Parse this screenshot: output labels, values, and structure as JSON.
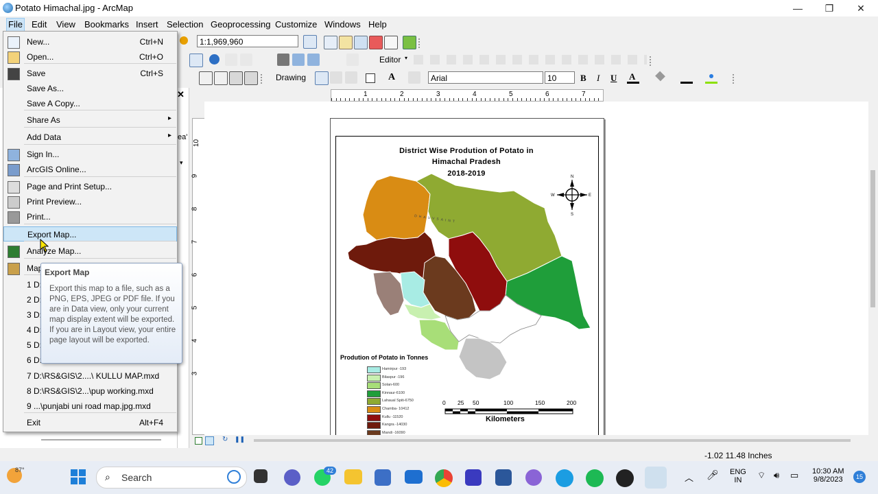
{
  "window": {
    "title": "Potato Himachal.jpg - ArcMap",
    "minimize": "—",
    "maximize": "❐",
    "close": "✕"
  },
  "menubar": [
    "File",
    "Edit",
    "View",
    "Bookmarks",
    "Insert",
    "Selection",
    "Geoprocessing",
    "Customize",
    "Windows",
    "Help"
  ],
  "toolbar": {
    "scale": "1:1,969,960",
    "editor": "Editor",
    "drawing": "Drawing",
    "font": "Arial",
    "font_size": "10",
    "bold": "B",
    "italic": "I",
    "underline": "U",
    "text_tool": "A"
  },
  "file_menu": {
    "items": [
      {
        "label": "New...",
        "shortcut": "Ctrl+N"
      },
      {
        "label": "Open...",
        "shortcut": "Ctrl+O"
      },
      {
        "label": "Save",
        "shortcut": "Ctrl+S"
      },
      {
        "label": "Save As...",
        "shortcut": ""
      },
      {
        "label": "Save A Copy...",
        "shortcut": ""
      },
      {
        "label": "Share As",
        "submenu": "▸"
      },
      {
        "label": "Add Data",
        "submenu": "▸"
      },
      {
        "label": "Sign In...",
        "shortcut": ""
      },
      {
        "label": "ArcGIS Online...",
        "shortcut": ""
      },
      {
        "label": "Page and Print Setup...",
        "shortcut": ""
      },
      {
        "label": "Print Preview...",
        "shortcut": ""
      },
      {
        "label": "Print...",
        "shortcut": ""
      },
      {
        "label": "Export Map...",
        "shortcut": ""
      },
      {
        "label": "Analyze Map...",
        "shortcut": ""
      },
      {
        "label": "Map",
        "shortcut": ""
      },
      {
        "label": "1 D:",
        "shortcut": ""
      },
      {
        "label": "2 D:",
        "shortcut": ""
      },
      {
        "label": "3 D:",
        "shortcut": ""
      },
      {
        "label": "4 D:",
        "shortcut": ""
      },
      {
        "label": "5 D:",
        "shortcut": ""
      },
      {
        "label": "6 D:",
        "shortcut": ""
      },
      {
        "label": "7 D:\\RS&GIS\\2....\\ KULLU MAP.mxd",
        "shortcut": ""
      },
      {
        "label": "8 D:\\RS&GIS\\2...\\pup working.mxd",
        "shortcut": ""
      },
      {
        "label": "9 ...\\punjabi uni road map.jpg.mxd",
        "shortcut": ""
      },
      {
        "label": "Exit",
        "shortcut": "Alt+F4"
      }
    ],
    "highlighted": "Export Map..."
  },
  "tooltip": {
    "title": "Export Map",
    "body": "Export this map to a file, such as a PNG, EPS, JPEG or PDF file. If you are in Data view, only your current map display extent will be exported. If you are in Layout view, your entire page layout will be exported."
  },
  "layout": {
    "map_title_line1": "District Wise Prodution of Potato in",
    "map_title_line2": "Himachal Pradesh",
    "map_title_line3": "2018-2019",
    "legend_title": "Prodution of Potato in Tonnes",
    "legend": [
      {
        "label": "Hamirpur -193",
        "color": "#a8ece4"
      },
      {
        "label": "Bilaspur -196",
        "color": "#c8f0b0"
      },
      {
        "label": "Solan-600",
        "color": "#a8de78"
      },
      {
        "label": "Kinnaur-6100",
        "color": "#1f9e3a"
      },
      {
        "label": "Lahaual Spiti-6750",
        "color": "#8faa32"
      },
      {
        "label": "Chamba- 10412",
        "color": "#d98c14"
      },
      {
        "label": "Kullu -11520",
        "color": "#8f0d0d"
      },
      {
        "label": "Kangra -14030",
        "color": "#6e1a0c"
      },
      {
        "label": "Mandi -16090",
        "color": "#6b3a1e"
      }
    ],
    "compass": {
      "n": "N",
      "s": "S",
      "e": "E",
      "w": "W"
    },
    "scale_ticks": [
      "0",
      "25",
      "50",
      "100",
      "150",
      "200"
    ],
    "scale_unit": "Kilometers",
    "region_label": "DHAUVSAINT",
    "hruler": [
      "1",
      "2",
      "3",
      "4",
      "5",
      "6",
      "7"
    ],
    "vruler": [
      "10",
      "9",
      "8",
      "7",
      "6",
      "5",
      "4",
      "3"
    ],
    "left_fragment": "ea'"
  },
  "status": {
    "coords": "-1.02  11.48 Inches"
  },
  "taskbar": {
    "weather": "87°",
    "search": "Search",
    "whatsapp_badge": "42",
    "lang1": "ENG",
    "lang2": "IN",
    "time": "10:30 AM",
    "date": "9/8/2023",
    "notif": "15"
  }
}
